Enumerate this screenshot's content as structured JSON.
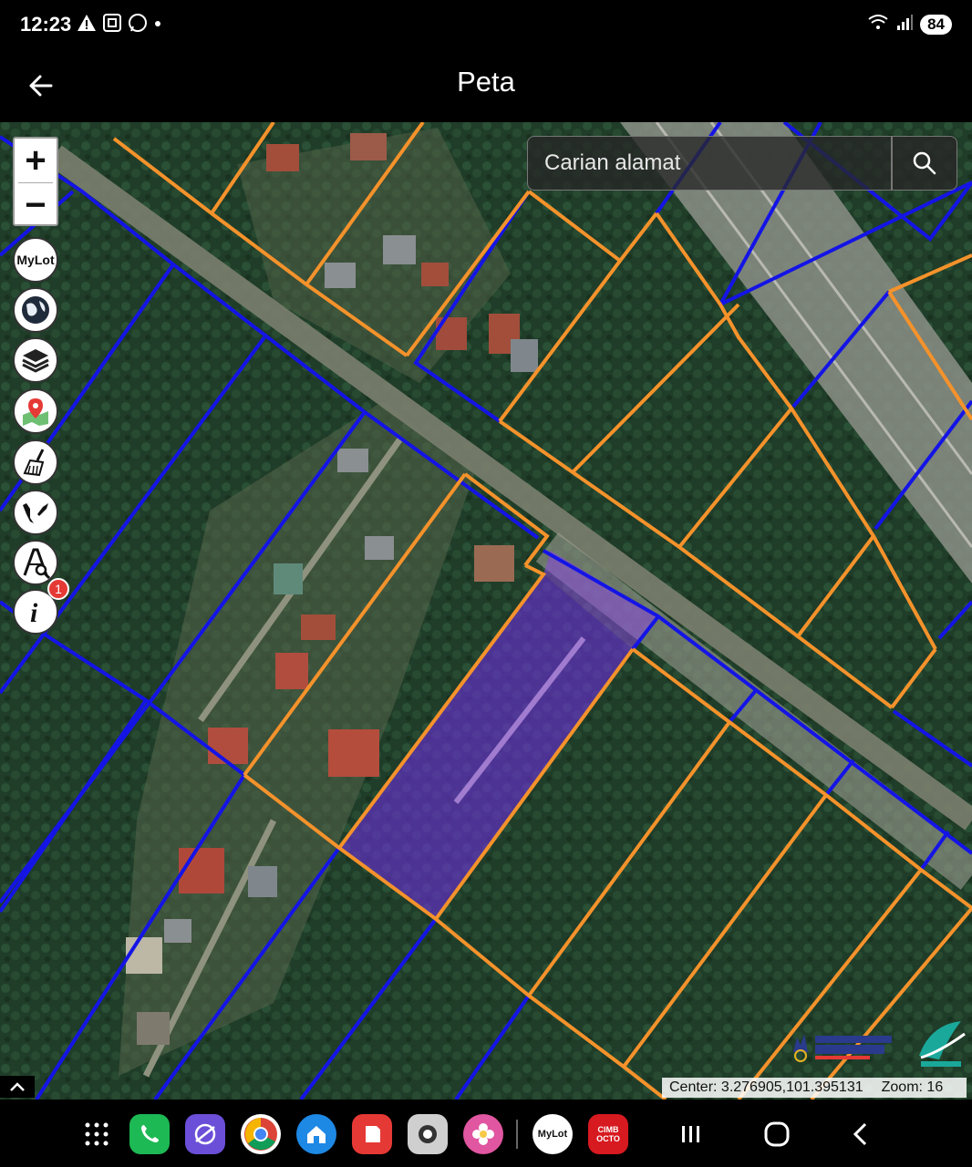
{
  "status_bar": {
    "time": "12:23",
    "battery": "84"
  },
  "app_bar": {
    "title": "Peta"
  },
  "search": {
    "placeholder": "Carian alamat"
  },
  "zoom": {
    "in_label": "+",
    "out_label": "−"
  },
  "tools": [
    {
      "name": "mylot-icon",
      "label": "MyLot"
    },
    {
      "name": "globe-icon"
    },
    {
      "name": "layers-icon"
    },
    {
      "name": "map-pin-icon"
    },
    {
      "name": "broom-icon"
    },
    {
      "name": "malaysia-map-icon"
    },
    {
      "name": "measure-search-icon"
    },
    {
      "name": "info-icon",
      "badge": "1"
    }
  ],
  "map_info": {
    "center": "Center: 3.276905,101.395131",
    "zoom": "Zoom: 16"
  },
  "colors": {
    "boundary_blue": "#1414e6",
    "boundary_orange": "#f5922b",
    "selected_fill": "#6a2fd6"
  },
  "dock": [
    {
      "name": "phone-app-icon",
      "color": "#1db954"
    },
    {
      "name": "internet-app-icon",
      "color": "#6b4fd8"
    },
    {
      "name": "chrome-app-icon",
      "color": "#ffffff"
    },
    {
      "name": "home-app-icon",
      "color": "#1e88e5"
    },
    {
      "name": "notes-app-icon",
      "color": "#e53935"
    },
    {
      "name": "camera-app-icon",
      "color": "#cfcfcf"
    },
    {
      "name": "gallery-app-icon",
      "color": "#e056a0"
    },
    {
      "name": "mylot-app-icon",
      "label": "MyLot",
      "color": "#ffffff"
    },
    {
      "name": "cimb-app-icon",
      "label": "CIMB OCTO",
      "color": "#d71920"
    }
  ]
}
